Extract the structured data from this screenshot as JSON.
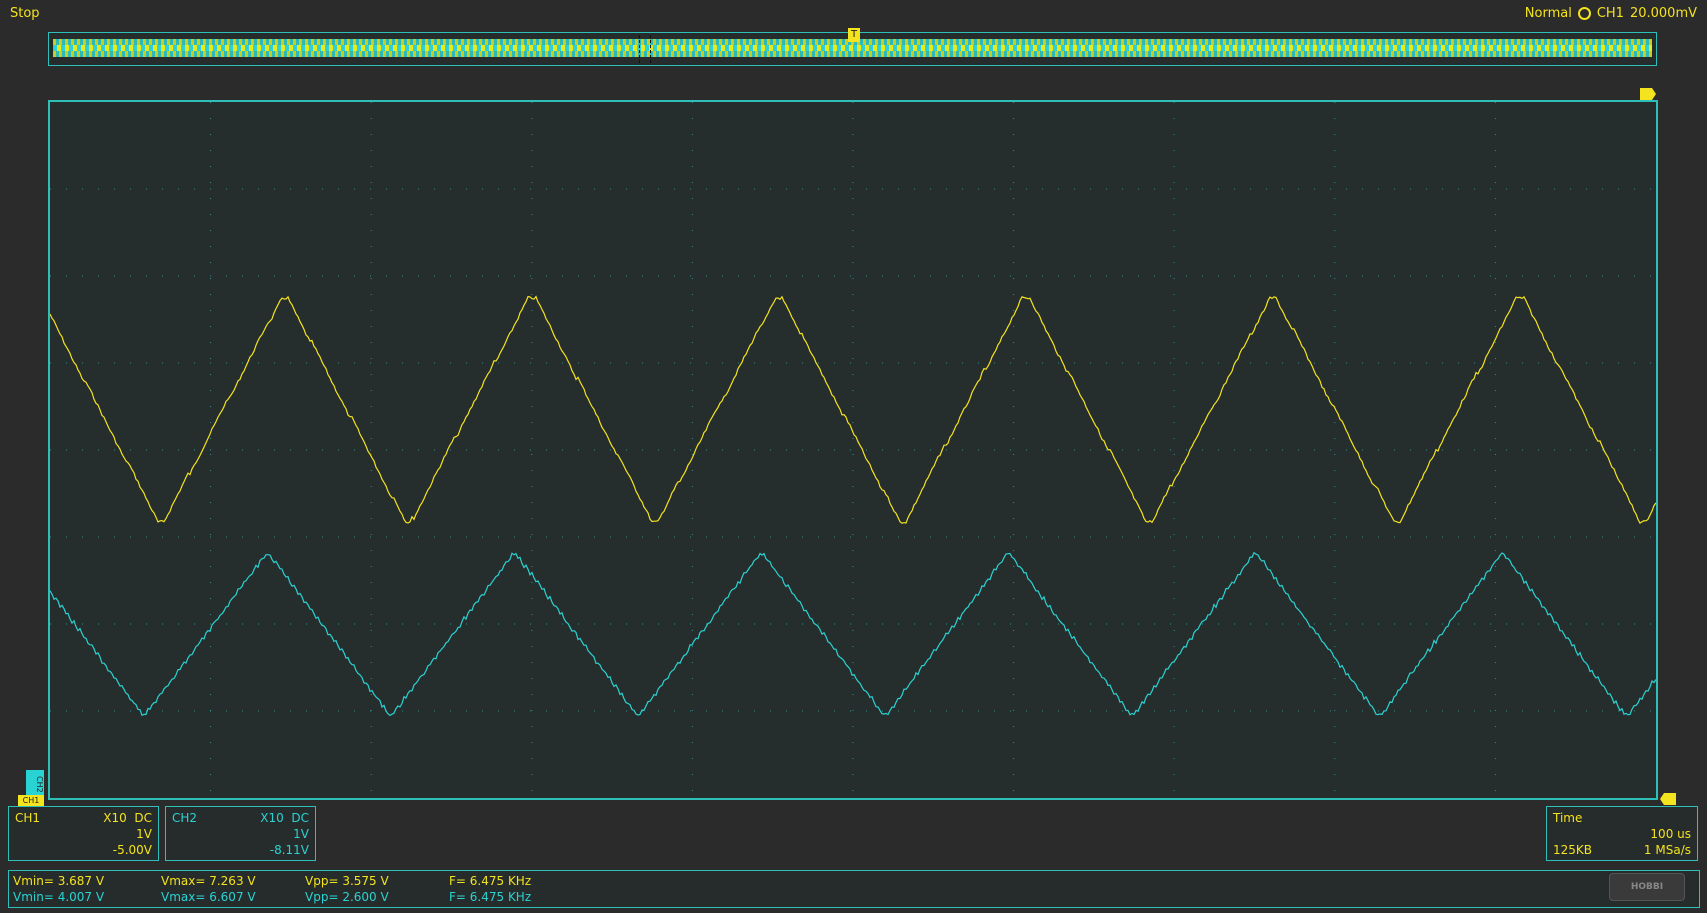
{
  "status": {
    "run_state": "Stop"
  },
  "trigger": {
    "mode": "Normal",
    "source": "CH1",
    "level": "20.000mV"
  },
  "overview": {
    "trigger_marker": "T"
  },
  "colors": {
    "ch1": "#f4e31f",
    "ch2": "#2ad3d3",
    "grid": "#2dbfb8",
    "screen": "#262d2d"
  },
  "channels": {
    "ch1": {
      "name": "CH1",
      "probe": "X10",
      "coupling": "DC",
      "scale": "1V",
      "offset": "-5.00V",
      "marker": "CH1"
    },
    "ch2": {
      "name": "CH2",
      "probe": "X10",
      "coupling": "DC",
      "scale": "1V",
      "offset": "-8.11V",
      "marker": "CH2"
    }
  },
  "timebase": {
    "label": "Time",
    "scale": "100 us",
    "memory": "125KB",
    "sample_rate": "1 MSa/s"
  },
  "measurements": [
    {
      "vmin": "Vmin= 3.687 V",
      "vmax": "Vmax= 7.263 V",
      "vpp": "Vpp= 3.575 V",
      "freq": "F= 6.475 KHz"
    },
    {
      "vmin": "Vmin= 4.007 V",
      "vmax": "Vmax= 6.607 V",
      "vpp": "Vpp= 2.600 V",
      "freq": "F= 6.475 KHz"
    }
  ],
  "logo": {
    "text": "HOBBI"
  },
  "waveforms": {
    "periods_on_screen": 6.5,
    "ch1_vmin": 3.687,
    "ch1_vmax": 7.263,
    "ch2_vmin": 4.007,
    "ch2_vmax": 6.607
  }
}
